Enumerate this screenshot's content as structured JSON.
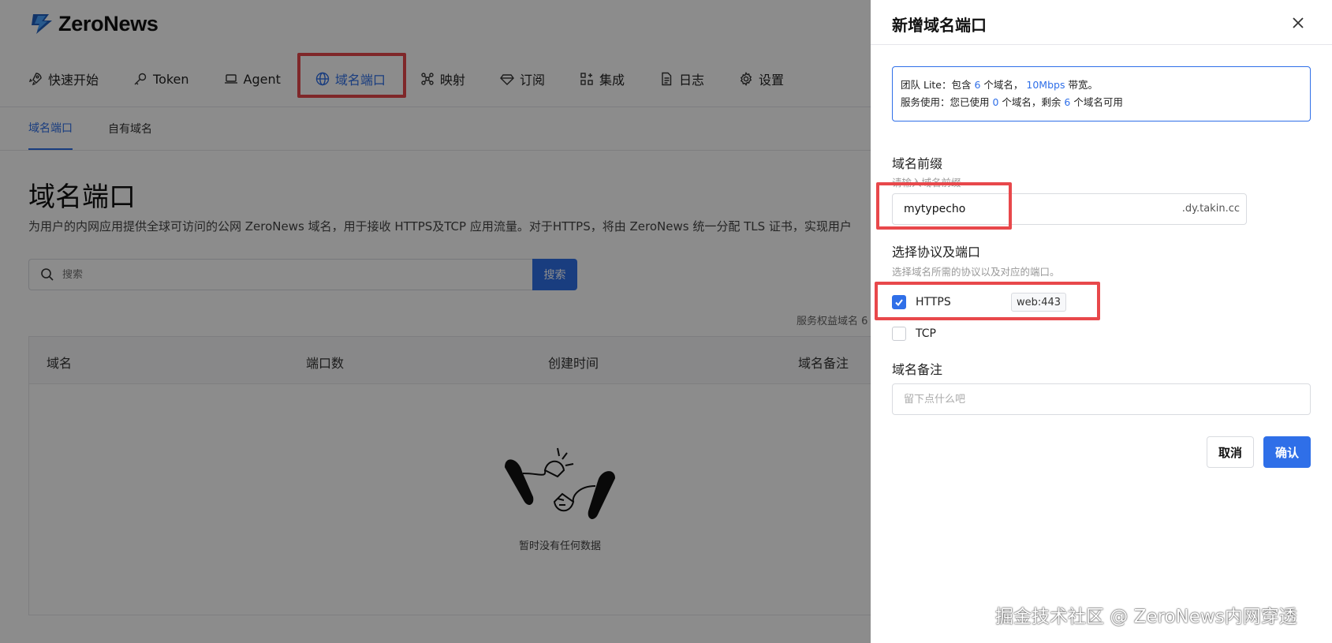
{
  "app": {
    "name": "ZeroNews"
  },
  "nav": {
    "items": [
      {
        "label": "快速开始",
        "icon": "rocket-icon"
      },
      {
        "label": "Token",
        "icon": "key-icon"
      },
      {
        "label": "Agent",
        "icon": "laptop-icon"
      },
      {
        "label": "域名端口",
        "icon": "globe-icon",
        "active": true
      },
      {
        "label": "映射",
        "icon": "network-icon"
      },
      {
        "label": "订阅",
        "icon": "diamond-icon"
      },
      {
        "label": "集成",
        "icon": "apps-icon"
      },
      {
        "label": "日志",
        "icon": "document-icon"
      },
      {
        "label": "设置",
        "icon": "gear-icon"
      }
    ]
  },
  "subtabs": [
    {
      "label": "域名端口",
      "active": true
    },
    {
      "label": "自有域名"
    }
  ],
  "main": {
    "title": "域名端口",
    "description": "为用户的内网应用提供全球可访问的公网 ZeroNews 域名，用于接收 HTTPS及TCP 应用流量。对于HTTPS，将由 ZeroNews 统一分配 TLS 证书，实现用户",
    "search_placeholder": "搜索",
    "search_button": "搜索",
    "quota_text": "服务权益域名 6",
    "table": {
      "columns": [
        "域名",
        "端口数",
        "创建时间",
        "域名备注"
      ],
      "rows": []
    },
    "empty_text": "暂时没有任何数据"
  },
  "drawer": {
    "title": "新增域名端口",
    "info": {
      "line1": {
        "prefix": "团队 Lite：包含 ",
        "domains": "6",
        "middle": " 个域名， ",
        "bandwidth": "10Mbps",
        "suffix": " 带宽。"
      },
      "line2": {
        "prefix": "服务使用：您已使用 ",
        "used": "0",
        "middle": " 个域名，剩余 ",
        "remaining": "6",
        "suffix": " 个域名可用"
      }
    },
    "prefix_field": {
      "label": "域名前缀",
      "hint": "请输入域名前缀",
      "value": "mytypecho",
      "suffix": ".dy.takin.cc"
    },
    "protocol_field": {
      "label": "选择协议及端口",
      "hint": "选择域名所需的协议以及对应的端口。",
      "options": [
        {
          "label": "HTTPS",
          "checked": true,
          "port": "web:443"
        },
        {
          "label": "TCP",
          "checked": false
        }
      ]
    },
    "remark_field": {
      "label": "域名备注",
      "placeholder": "留下点什么吧"
    },
    "cancel_label": "取消",
    "confirm_label": "确认"
  },
  "watermark": "掘金技术社区 @ ZeroNews内网穿透",
  "colors": {
    "accent": "#2f6fe8",
    "highlight": "#e8484b",
    "overlay": "rgba(0,0,0,0.45)"
  }
}
